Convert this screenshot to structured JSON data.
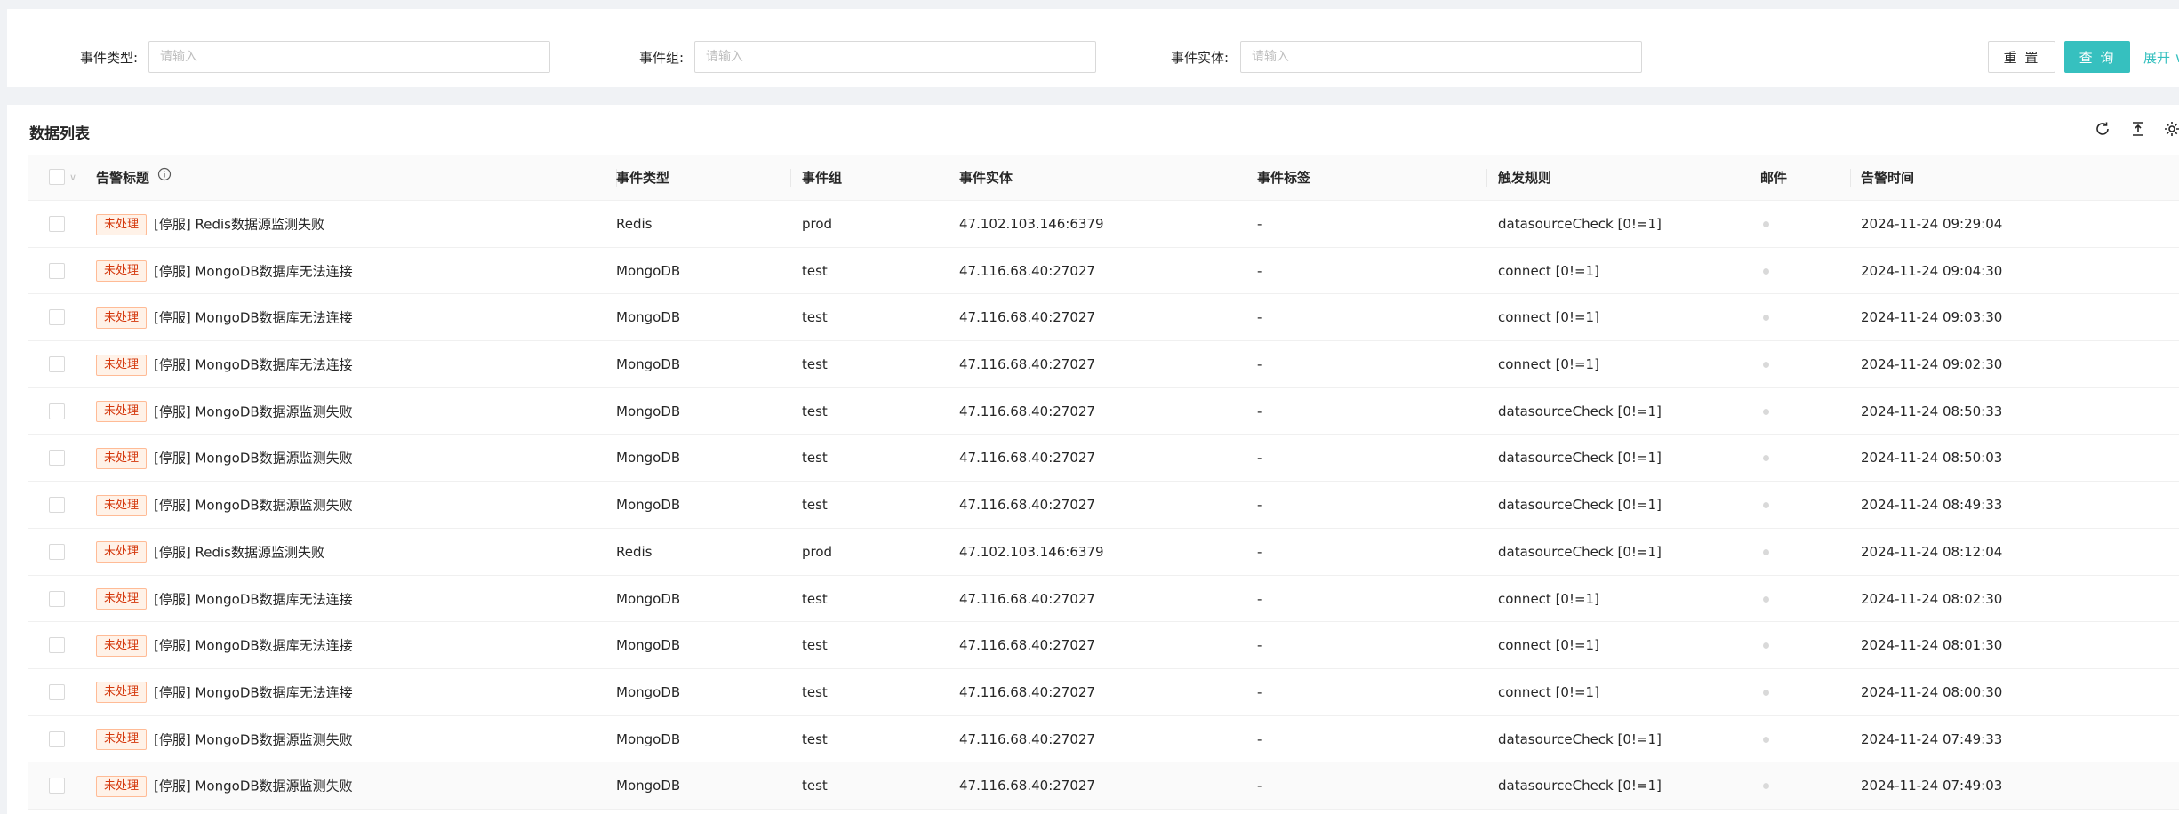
{
  "filters": {
    "event_type": {
      "label": "事件类型:",
      "placeholder": "请输入"
    },
    "event_group": {
      "label": "事件组:",
      "placeholder": "请输入"
    },
    "event_entity": {
      "label": "事件实体:",
      "placeholder": "请输入"
    },
    "reset_label": "重 置",
    "query_label": "查 询",
    "expand_label": "展开 ∨"
  },
  "list": {
    "title": "数据列表",
    "toolbar_icons": [
      "refresh-icon",
      "column-height-icon",
      "setting-icon"
    ]
  },
  "table": {
    "columns": [
      "告警标题",
      "事件类型",
      "事件组",
      "事件实体",
      "事件标签",
      "触发规则",
      "邮件",
      "告警时间"
    ],
    "rows": [
      {
        "status": "未处理",
        "title": "[停服] Redis数据源监测失败",
        "type": "Redis",
        "group": "prod",
        "entity": "47.102.103.146:6379",
        "tag": "-",
        "rule": "datasourceCheck [0!=1]",
        "time": "2024-11-24 09:29:04"
      },
      {
        "status": "未处理",
        "title": "[停服] MongoDB数据库无法连接",
        "type": "MongoDB",
        "group": "test",
        "entity": "47.116.68.40:27027",
        "tag": "-",
        "rule": "connect [0!=1]",
        "time": "2024-11-24 09:04:30"
      },
      {
        "status": "未处理",
        "title": "[停服] MongoDB数据库无法连接",
        "type": "MongoDB",
        "group": "test",
        "entity": "47.116.68.40:27027",
        "tag": "-",
        "rule": "connect [0!=1]",
        "time": "2024-11-24 09:03:30"
      },
      {
        "status": "未处理",
        "title": "[停服] MongoDB数据库无法连接",
        "type": "MongoDB",
        "group": "test",
        "entity": "47.116.68.40:27027",
        "tag": "-",
        "rule": "connect [0!=1]",
        "time": "2024-11-24 09:02:30"
      },
      {
        "status": "未处理",
        "title": "[停服] MongoDB数据源监测失败",
        "type": "MongoDB",
        "group": "test",
        "entity": "47.116.68.40:27027",
        "tag": "-",
        "rule": "datasourceCheck [0!=1]",
        "time": "2024-11-24 08:50:33"
      },
      {
        "status": "未处理",
        "title": "[停服] MongoDB数据源监测失败",
        "type": "MongoDB",
        "group": "test",
        "entity": "47.116.68.40:27027",
        "tag": "-",
        "rule": "datasourceCheck [0!=1]",
        "time": "2024-11-24 08:50:03"
      },
      {
        "status": "未处理",
        "title": "[停服] MongoDB数据源监测失败",
        "type": "MongoDB",
        "group": "test",
        "entity": "47.116.68.40:27027",
        "tag": "-",
        "rule": "datasourceCheck [0!=1]",
        "time": "2024-11-24 08:49:33"
      },
      {
        "status": "未处理",
        "title": "[停服] Redis数据源监测失败",
        "type": "Redis",
        "group": "prod",
        "entity": "47.102.103.146:6379",
        "tag": "-",
        "rule": "datasourceCheck [0!=1]",
        "time": "2024-11-24 08:12:04"
      },
      {
        "status": "未处理",
        "title": "[停服] MongoDB数据库无法连接",
        "type": "MongoDB",
        "group": "test",
        "entity": "47.116.68.40:27027",
        "tag": "-",
        "rule": "connect [0!=1]",
        "time": "2024-11-24 08:02:30"
      },
      {
        "status": "未处理",
        "title": "[停服] MongoDB数据库无法连接",
        "type": "MongoDB",
        "group": "test",
        "entity": "47.116.68.40:27027",
        "tag": "-",
        "rule": "connect [0!=1]",
        "time": "2024-11-24 08:01:30"
      },
      {
        "status": "未处理",
        "title": "[停服] MongoDB数据库无法连接",
        "type": "MongoDB",
        "group": "test",
        "entity": "47.116.68.40:27027",
        "tag": "-",
        "rule": "connect [0!=1]",
        "time": "2024-11-24 08:00:30"
      },
      {
        "status": "未处理",
        "title": "[停服] MongoDB数据源监测失败",
        "type": "MongoDB",
        "group": "test",
        "entity": "47.116.68.40:27027",
        "tag": "-",
        "rule": "datasourceCheck [0!=1]",
        "time": "2024-11-24 07:49:33"
      },
      {
        "status": "未处理",
        "title": "[停服] MongoDB数据源监测失败",
        "type": "MongoDB",
        "group": "test",
        "entity": "47.116.68.40:27027",
        "tag": "-",
        "rule": "datasourceCheck [0!=1]",
        "time": "2024-11-24 07:49:03"
      }
    ]
  },
  "colors": {
    "accent": "#36c0bf",
    "badge_text": "#d4380d",
    "badge_bg": "#fff2e8",
    "badge_border": "#ffbb96"
  }
}
